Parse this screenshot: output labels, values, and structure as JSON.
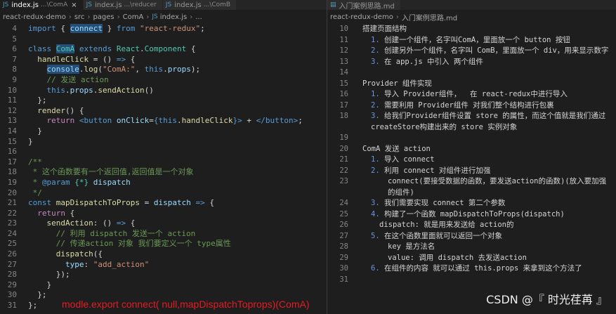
{
  "left_pane": {
    "tabs": [
      {
        "name": "index.js",
        "desc": "...\\ComA",
        "active": true
      },
      {
        "name": "index.js",
        "desc": "...\\reducer",
        "active": false
      },
      {
        "name": "index.js",
        "desc": "...\\ComB",
        "active": false
      }
    ],
    "breadcrumb": [
      "react-redux-demo",
      "src",
      "pages",
      "ComA",
      "index.js",
      "..."
    ],
    "code": [
      {
        "n": "4",
        "tokens": [
          [
            "k",
            "import"
          ],
          [
            "p",
            " { "
          ],
          [
            "v",
            "connect"
          ],
          [
            "p",
            " } "
          ],
          [
            "k",
            "from"
          ],
          [
            "s",
            " \"react-redux\""
          ],
          [
            "p",
            ";"
          ]
        ]
      },
      {
        "n": "5",
        "tokens": []
      },
      {
        "n": "6",
        "tokens": [
          [
            "k",
            "class"
          ],
          [
            "p",
            " "
          ],
          [
            "t",
            "ComA"
          ],
          [
            "p",
            " "
          ],
          [
            "k",
            "extends"
          ],
          [
            "p",
            " "
          ],
          [
            "t",
            "React"
          ],
          [
            "p",
            "."
          ],
          [
            "t",
            "Component"
          ],
          [
            "p",
            " {"
          ]
        ]
      },
      {
        "n": "7",
        "tokens": [
          [
            "p",
            "  "
          ],
          [
            "f",
            "handleClick"
          ],
          [
            "p",
            " = () "
          ],
          [
            "k",
            "=>"
          ],
          [
            "p",
            " {"
          ]
        ]
      },
      {
        "n": "8",
        "tokens": [
          [
            "p",
            "    "
          ],
          [
            "v",
            "console"
          ],
          [
            "p",
            "."
          ],
          [
            "f",
            "log"
          ],
          [
            "p",
            "("
          ],
          [
            "s",
            "\"ComA:\""
          ],
          [
            "p",
            ", "
          ],
          [
            "k",
            "this"
          ],
          [
            "p",
            "."
          ],
          [
            "v",
            "props"
          ],
          [
            "p",
            ");"
          ]
        ]
      },
      {
        "n": "9",
        "tokens": [
          [
            "p",
            "    "
          ],
          [
            "cm",
            "// 发送 action"
          ]
        ]
      },
      {
        "n": "10",
        "tokens": [
          [
            "p",
            "    "
          ],
          [
            "k",
            "this"
          ],
          [
            "p",
            "."
          ],
          [
            "v",
            "props"
          ],
          [
            "p",
            "."
          ],
          [
            "f",
            "sendAction"
          ],
          [
            "p",
            "()"
          ]
        ]
      },
      {
        "n": "11",
        "tokens": [
          [
            "p",
            "  };"
          ]
        ]
      },
      {
        "n": "12",
        "tokens": [
          [
            "p",
            "  "
          ],
          [
            "f",
            "render"
          ],
          [
            "p",
            "() {"
          ]
        ]
      },
      {
        "n": "13",
        "tokens": [
          [
            "p",
            "    "
          ],
          [
            "c",
            "return"
          ],
          [
            "p",
            " "
          ],
          [
            "tag",
            "<"
          ],
          [
            "tag",
            "button"
          ],
          [
            "p",
            " "
          ],
          [
            "v",
            "onClick"
          ],
          [
            "p",
            "="
          ],
          [
            "k",
            "{"
          ],
          [
            "k",
            "this"
          ],
          [
            "p",
            "."
          ],
          [
            "f",
            "handleClick"
          ],
          [
            "k",
            "}"
          ],
          [
            "tag",
            ">"
          ],
          [
            "p",
            " + "
          ],
          [
            "tag",
            "</"
          ],
          [
            "tag",
            "button"
          ],
          [
            "tag",
            ">"
          ],
          [
            "p",
            ";"
          ]
        ]
      },
      {
        "n": "14",
        "tokens": [
          [
            "p",
            "  }"
          ]
        ]
      },
      {
        "n": "15",
        "tokens": [
          [
            "p",
            "}"
          ]
        ]
      },
      {
        "n": "16",
        "tokens": []
      },
      {
        "n": "17",
        "tokens": [
          [
            "cm",
            "/**"
          ]
        ]
      },
      {
        "n": "18",
        "tokens": [
          [
            "cm",
            " * 这个函数要有一个返回值,返回值是一个对象"
          ]
        ]
      },
      {
        "n": "19",
        "tokens": [
          [
            "cm",
            " * "
          ],
          [
            "k",
            "@param"
          ],
          [
            "p",
            " "
          ],
          [
            "t",
            "{*}"
          ],
          [
            "p",
            " "
          ],
          [
            "v",
            "dispatch"
          ]
        ]
      },
      {
        "n": "20",
        "tokens": [
          [
            "cm",
            " */"
          ]
        ]
      },
      {
        "n": "21",
        "tokens": [
          [
            "k",
            "const"
          ],
          [
            "p",
            " "
          ],
          [
            "f",
            "mapDispatchToProps"
          ],
          [
            "p",
            " = "
          ],
          [
            "v",
            "dispatch"
          ],
          [
            "p",
            " "
          ],
          [
            "k",
            "=>"
          ],
          [
            "p",
            " {"
          ]
        ]
      },
      {
        "n": "22",
        "tokens": [
          [
            "p",
            "  "
          ],
          [
            "c",
            "return"
          ],
          [
            "p",
            " {"
          ]
        ]
      },
      {
        "n": "23",
        "tokens": [
          [
            "p",
            "    "
          ],
          [
            "f",
            "sendAction"
          ],
          [
            "p",
            ": () "
          ],
          [
            "k",
            "=>"
          ],
          [
            "p",
            " {"
          ]
        ]
      },
      {
        "n": "24",
        "tokens": [
          [
            "p",
            "      "
          ],
          [
            "cm",
            "// 利用 dispatch 发送一个 action"
          ]
        ]
      },
      {
        "n": "25",
        "tokens": [
          [
            "p",
            "      "
          ],
          [
            "cm",
            "// 传递action 对象 我们要定义一个 type属性"
          ]
        ]
      },
      {
        "n": "26",
        "tokens": [
          [
            "p",
            "      "
          ],
          [
            "f",
            "dispatch"
          ],
          [
            "p",
            "({"
          ]
        ]
      },
      {
        "n": "27",
        "tokens": [
          [
            "p",
            "        "
          ],
          [
            "v",
            "type"
          ],
          [
            "p",
            ": "
          ],
          [
            "s",
            "\"add_action\""
          ]
        ]
      },
      {
        "n": "28",
        "tokens": [
          [
            "p",
            "      });"
          ]
        ]
      },
      {
        "n": "29",
        "tokens": [
          [
            "p",
            "    }"
          ]
        ]
      },
      {
        "n": "30",
        "tokens": [
          [
            "p",
            "  };"
          ]
        ]
      },
      {
        "n": "31",
        "tokens": [
          [
            "p",
            "};"
          ]
        ]
      }
    ],
    "overlay_note": "modle.export connect( null,mapDispatchToprops)(ComA)"
  },
  "right_pane": {
    "tab": {
      "name": "入门案例思路.md"
    },
    "breadcrumb": [
      "react-redux-demo",
      "入门案例思路.md"
    ],
    "lines": [
      {
        "n": "10",
        "indent": 0,
        "num": "",
        "text": "搭建页面结构"
      },
      {
        "n": "11",
        "indent": 1,
        "num": "1.",
        "text": "创建一个组件，名字叫ComA，里面放一个 button 按钮"
      },
      {
        "n": "12",
        "indent": 1,
        "num": "2.",
        "text": "创建另外一个组件，名字叫 ComB，里面放一个 div，用来显示数字"
      },
      {
        "n": "13",
        "indent": 1,
        "num": "3.",
        "text": "在 app.js 中引入 两个组件"
      },
      {
        "n": "14",
        "indent": 0,
        "num": "",
        "text": ""
      },
      {
        "n": "15",
        "indent": 0,
        "num": "",
        "text": "Provider 组件实现"
      },
      {
        "n": "16",
        "indent": 1,
        "num": "1.",
        "text": "导入 Provider组件，  在 react-redux中进行导入"
      },
      {
        "n": "17",
        "indent": 1,
        "num": "2.",
        "text": "需要利用 Provider组件 对我们整个结构进行包裹"
      },
      {
        "n": "18",
        "indent": 1,
        "num": "3.",
        "text": "给我们Provider组件设置 store 的属性，而这个值就是我们通过"
      },
      {
        "n": "",
        "indent": 1,
        "num": "",
        "text": "createStore构建出来的 store 实例对象"
      },
      {
        "n": "19",
        "indent": 0,
        "num": "",
        "text": ""
      },
      {
        "n": "20",
        "indent": 0,
        "num": "",
        "text": "ComA 发送 action"
      },
      {
        "n": "21",
        "indent": 1,
        "num": "1.",
        "text": "导入 connect"
      },
      {
        "n": "22",
        "indent": 1,
        "num": "2.",
        "text": "利用 connect 对组件进行加强"
      },
      {
        "n": "23",
        "indent": 3,
        "num": "",
        "text": "connect(要接受数据的函数，要发送action的函数)(放入要加强"
      },
      {
        "n": "",
        "indent": 3,
        "num": "",
        "text": "的组件)"
      },
      {
        "n": "24",
        "indent": 1,
        "num": "3.",
        "text": "我们需要实现 connect 第二个参数"
      },
      {
        "n": "25",
        "indent": 1,
        "num": "4.",
        "text": "构建了一个函数 mapDispatchToProps(dispatch)"
      },
      {
        "n": "26",
        "indent": 2,
        "num": "",
        "text": "dispatch: 就是用来发送给 action的"
      },
      {
        "n": "27",
        "indent": 1,
        "num": "5.",
        "text": "在这个函数里面就可以返回一个对象"
      },
      {
        "n": "28",
        "indent": 3,
        "num": "",
        "text": "key 是方法名"
      },
      {
        "n": "29",
        "indent": 3,
        "num": "",
        "text": "value: 调用 dispatch 去发送action"
      },
      {
        "n": "30",
        "indent": 1,
        "num": "6.",
        "text": "在组件的内容 就可以通过 this.props 来拿到这个方法了"
      },
      {
        "n": "31",
        "indent": 0,
        "num": "",
        "text": ""
      }
    ]
  },
  "watermark": "CSDN @『 时光荏苒 』",
  "colors": {
    "background": "#1e1e1e",
    "keyword": "#569cd6",
    "control": "#c586c0",
    "function": "#dcdcaa",
    "string": "#ce9178",
    "variable": "#9cdcfe",
    "type": "#4ec9b0",
    "comment": "#6a9955",
    "overlay_note": "#e51c23"
  }
}
